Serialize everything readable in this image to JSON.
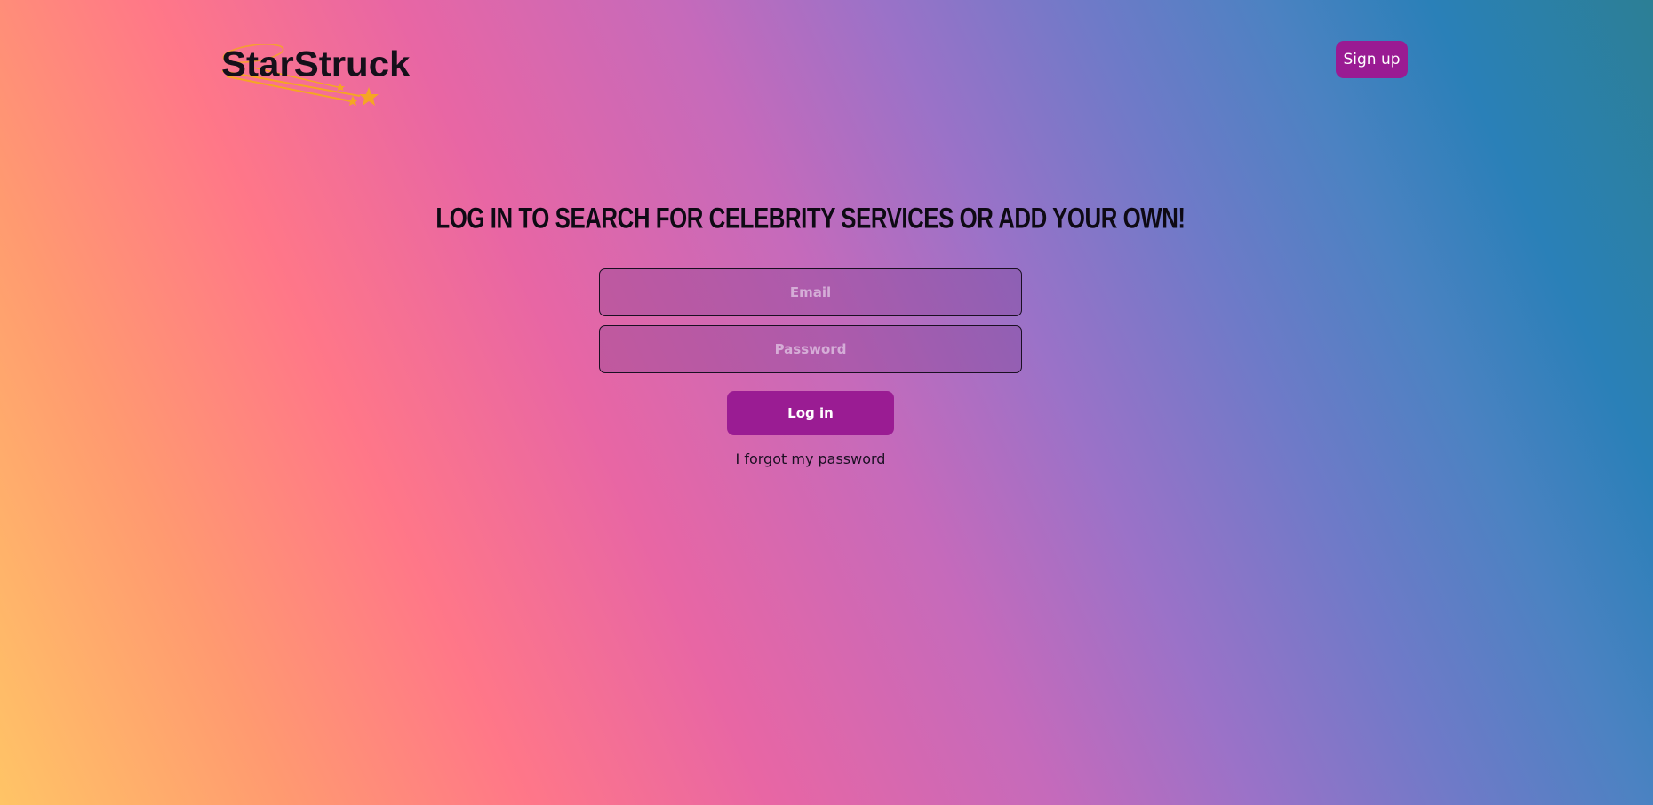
{
  "header": {
    "logo_text": "StarStruck",
    "signup_label": "Sign up"
  },
  "main": {
    "headline": "LOG IN TO SEARCH FOR CELEBRITY SERVICES OR ADD YOUR OWN!",
    "email_placeholder": "Email",
    "password_placeholder": "Password",
    "login_label": "Log in",
    "forgot_label": "I forgot my password"
  },
  "colors": {
    "accent": "#9a1c93",
    "logo_star": "#f5a623",
    "text_dark": "#0e0a14"
  },
  "icons": [
    "shooting-star-icon"
  ]
}
